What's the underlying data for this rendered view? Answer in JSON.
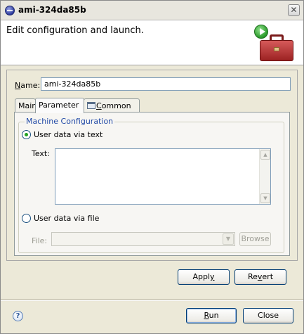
{
  "window": {
    "title": "ami-324da85b",
    "close_glyph": "✕",
    "icon": "eclipse-icon"
  },
  "banner": {
    "title": "Edit configuration and launch.",
    "icon": "toolbox-run-icon"
  },
  "name_field": {
    "label_mnemonic": "N",
    "label_rest": "ame:",
    "value": "ami-324da85b"
  },
  "tabs": [
    {
      "label": "Main",
      "active": false
    },
    {
      "label": "Parameter",
      "active": true
    },
    {
      "label_mnemonic": "C",
      "label_rest": "ommon",
      "active": false,
      "icon": "table-icon"
    }
  ],
  "machine_config": {
    "group_title": "Machine Configuration",
    "user_data_text_label": "User data via text",
    "user_data_text_selected": true,
    "text_label": "Text:",
    "text_value": "",
    "user_data_file_label": "User data via file",
    "user_data_file_selected": false,
    "file_label": "File:",
    "file_value": "",
    "browse_label": "Browse"
  },
  "actions": {
    "apply_mnemonic": "y",
    "apply_pre": "Appl",
    "apply_post": "",
    "revert_pre": "Re",
    "revert_mnemonic": "v",
    "revert_post": "ert"
  },
  "footer": {
    "help_glyph": "?",
    "run_mnemonic": "R",
    "run_rest": "un",
    "close_label": "Close"
  },
  "colors": {
    "group_title": "#1f48a6",
    "radio_selected": "#21a121",
    "button_border": "#003c74"
  }
}
